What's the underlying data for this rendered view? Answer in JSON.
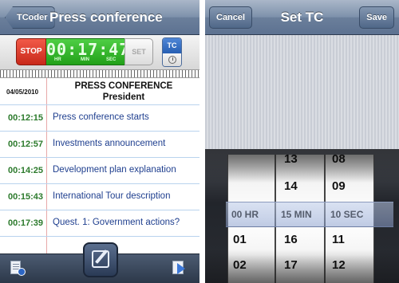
{
  "left": {
    "nav": {
      "back": "TCoder",
      "title": "Press conference"
    },
    "controls": {
      "stop": "STOP",
      "timer": "00:17:47",
      "units": [
        "HR",
        "MIN",
        "SEC"
      ],
      "set": "SET",
      "tc": "TC"
    },
    "notes": {
      "date": "04/05/2010",
      "title": "PRESS CONFERENCE",
      "subtitle": "President",
      "entries": [
        {
          "time": "00:12:15",
          "text": "Press conference starts"
        },
        {
          "time": "00:12:57",
          "text": "Investments announcement"
        },
        {
          "time": "00:14:25",
          "text": "Development plan explanation"
        },
        {
          "time": "00:15:43",
          "text": "International Tour description"
        },
        {
          "time": "00:17:39",
          "text": "Quest. 1: Government actions?"
        }
      ]
    }
  },
  "right": {
    "nav": {
      "cancel": "Cancel",
      "title": "Set TC",
      "save": "Save"
    },
    "picker": {
      "hours": [
        "",
        "",
        "00 HR",
        "01",
        "02"
      ],
      "minutes": [
        "13",
        "14",
        "15 MIN",
        "16",
        "17"
      ],
      "seconds": [
        "08",
        "09",
        "10 SEC",
        "11",
        "12"
      ]
    }
  }
}
